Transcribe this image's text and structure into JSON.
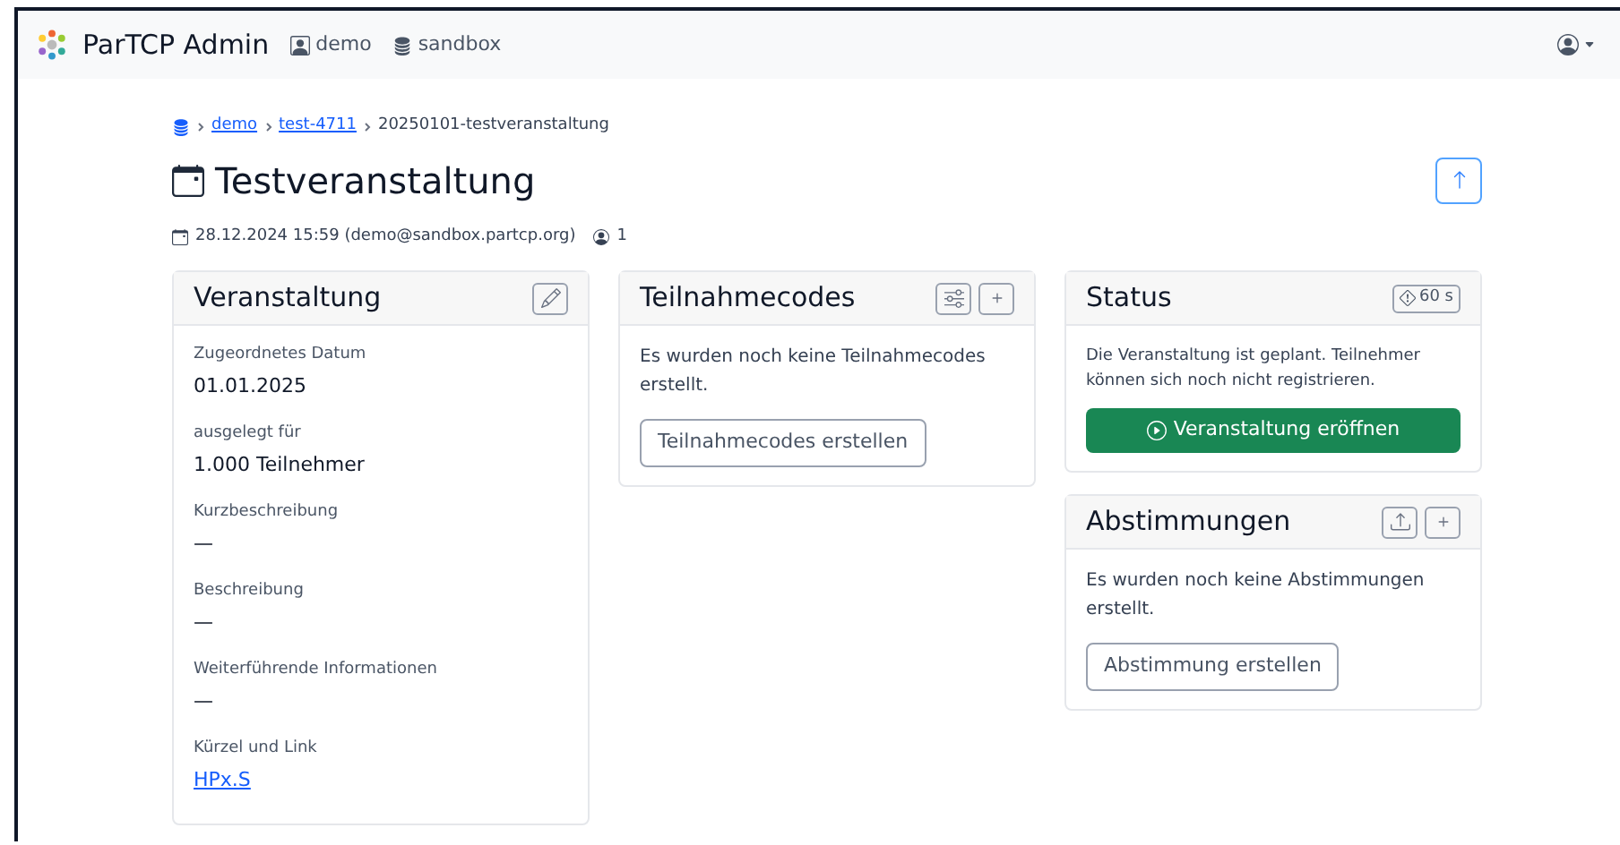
{
  "navbar": {
    "brand": "ParTCP Admin",
    "items": [
      {
        "kind": "user",
        "label": "demo"
      },
      {
        "kind": "server",
        "label": "sandbox"
      }
    ]
  },
  "breadcrumb": [
    {
      "kind": "link",
      "label": "demo"
    },
    {
      "kind": "link",
      "label": "test-4711"
    },
    {
      "kind": "text",
      "label": "20250101-testveranstaltung"
    }
  ],
  "title": "Testveranstaltung",
  "meta": {
    "created": "28.12.2024 15:59 (demo@sandbox.partcp.org)",
    "participants": "1"
  },
  "event_card": {
    "title": "Veranstaltung",
    "fields": [
      {
        "label": "Zugeordnetes Datum",
        "value": "01.01.2025",
        "kind": "text"
      },
      {
        "label": "ausgelegt für",
        "value": "1.000 Teilnehmer",
        "kind": "text"
      },
      {
        "label": "Kurzbeschreibung",
        "value": "—",
        "kind": "text"
      },
      {
        "label": "Beschreibung",
        "value": "—",
        "kind": "text"
      },
      {
        "label": "Weiterführende Informationen",
        "value": "—",
        "kind": "text"
      },
      {
        "label": "Kürzel und Link",
        "value": "HPx.S",
        "kind": "link"
      }
    ]
  },
  "codes_card": {
    "title": "Teilnahmecodes",
    "message": "Es wurden noch keine Teilnahmecodes erstellt.",
    "button": "Teilnahmecodes erstellen"
  },
  "status_card": {
    "title": "Status",
    "timer": "60 s",
    "message": "Die Veranstaltung ist geplant. Teilnehmer können sich noch nicht registrieren.",
    "button": "Veranstaltung eröffnen"
  },
  "votes_card": {
    "title": "Abstimmungen",
    "message": "Es wurden noch keine Abstimmungen erstellt.",
    "button": "Abstimmung erstellen"
  }
}
